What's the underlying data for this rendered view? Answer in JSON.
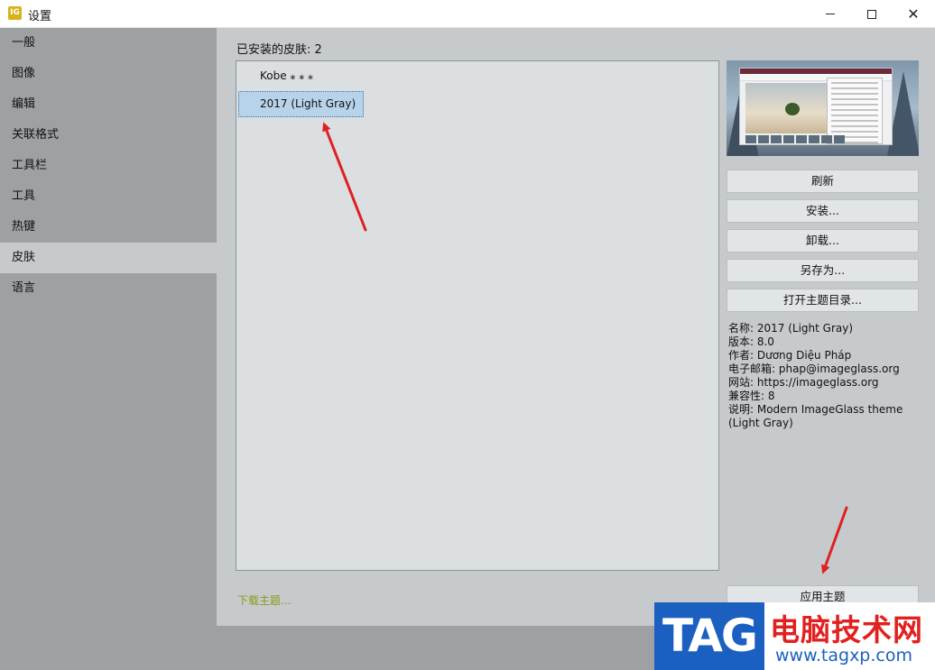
{
  "window": {
    "title": "设置",
    "app_icon_text": "IG"
  },
  "sidebar": {
    "items": [
      {
        "label": "一般"
      },
      {
        "label": "图像"
      },
      {
        "label": "编辑"
      },
      {
        "label": "关联格式"
      },
      {
        "label": "工具栏"
      },
      {
        "label": "工具"
      },
      {
        "label": "热键"
      },
      {
        "label": "皮肤",
        "active": true
      },
      {
        "label": "语言"
      }
    ]
  },
  "skins": {
    "installed_label": "已安装的皮肤: 2",
    "list": [
      {
        "label": "Kobe ⁎ ⁎ ⁎"
      },
      {
        "label": "2017 (Light Gray)",
        "selected": true
      }
    ],
    "download_link": "下载主题..."
  },
  "actions": {
    "refresh": "刷新",
    "install": "安装...",
    "uninstall": "卸载...",
    "save_as": "另存为...",
    "open_dir": "打开主题目录...",
    "apply": "应用主题"
  },
  "info": {
    "name": "名称: 2017 (Light Gray)",
    "version": "版本: 8.0",
    "author": "作者: Dương Diệu Pháp",
    "email": "电子邮箱: phap@imageglass.org",
    "website": "网站: https://imageglass.org",
    "compat": "兼容性: 8",
    "description": "说明: Modern ImageGlass theme (Light Gray)"
  },
  "watermark": {
    "tag": "TAG",
    "cn": "电脑技术网",
    "url": "www.tagxp.com"
  },
  "colors": {
    "sidebar_bg": "#9da1a4",
    "content_bg": "#c6cacc",
    "list_bg": "#dbdfe1",
    "selection": "#b7d3ea",
    "link": "#8a9a18",
    "annotation_arrow": "#e02020"
  }
}
